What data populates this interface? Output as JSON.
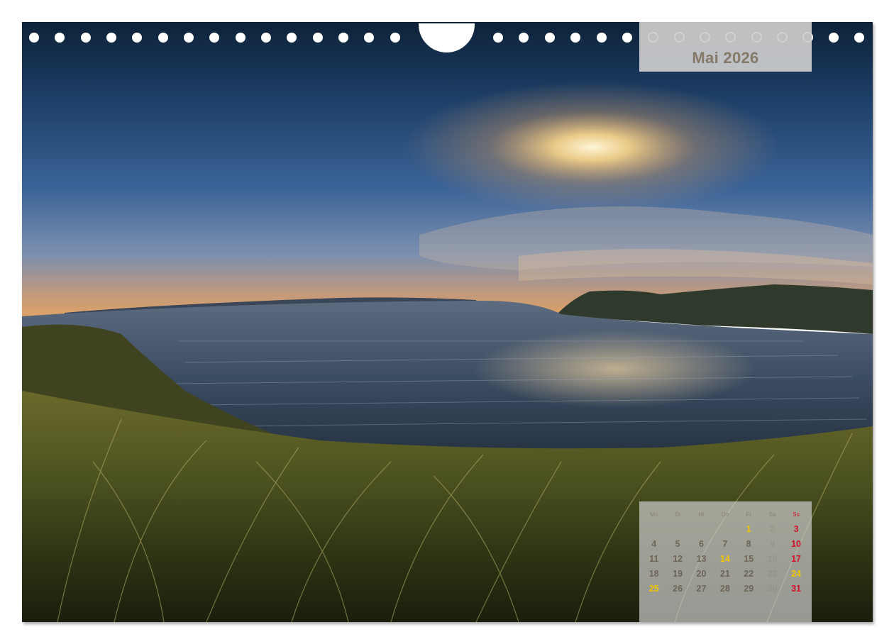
{
  "calendar": {
    "month_title": "Mai 2026",
    "weekdays": [
      "Mo",
      "Di",
      "Mi",
      "Do",
      "Fr",
      "Sa",
      "So"
    ],
    "weeks": [
      [
        "",
        "",
        "",
        "",
        "1",
        "2",
        "3"
      ],
      [
        "4",
        "5",
        "6",
        "7",
        "8",
        "9",
        "10"
      ],
      [
        "11",
        "12",
        "13",
        "14",
        "15",
        "16",
        "17"
      ],
      [
        "18",
        "19",
        "20",
        "21",
        "22",
        "23",
        "24"
      ],
      [
        "25",
        "26",
        "27",
        "28",
        "29",
        "30",
        "31"
      ]
    ]
  },
  "colors": {
    "month_text": "#857a6a",
    "sunday": "#d3112a",
    "holiday": "#f2c500",
    "day_text": "#6e6558"
  }
}
